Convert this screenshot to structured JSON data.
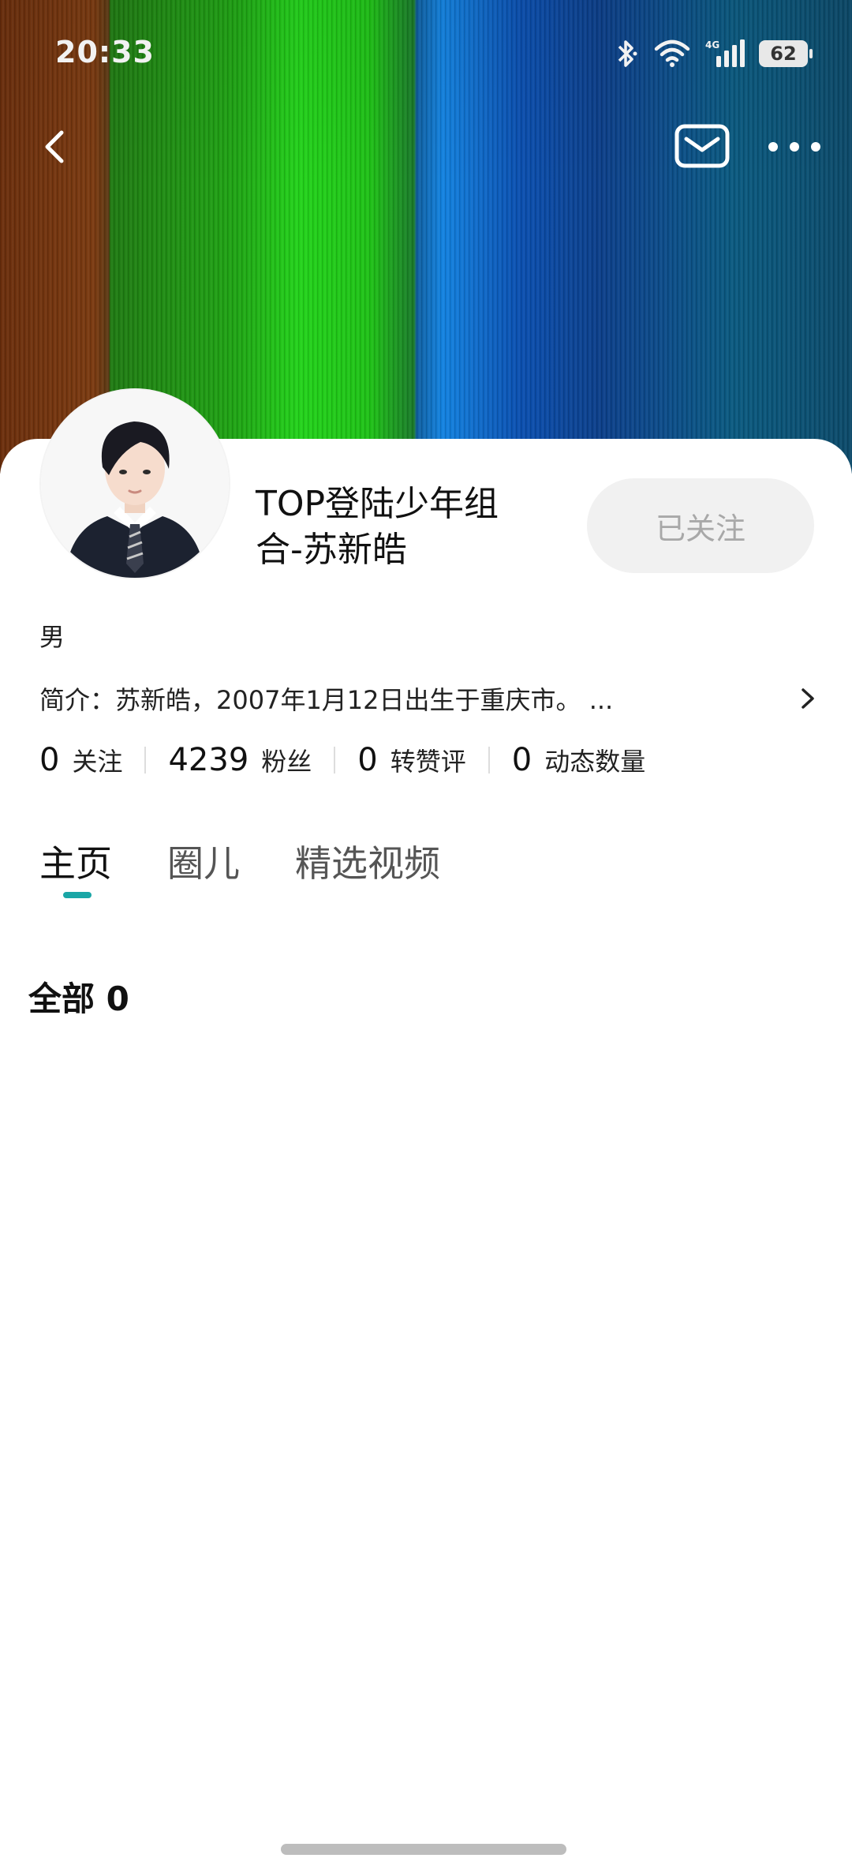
{
  "status_bar": {
    "time": "20:33",
    "battery_level": "62",
    "icons": [
      "bluetooth-icon",
      "wifi-icon",
      "4g-signal-icon",
      "battery-icon"
    ]
  },
  "header": {
    "back_icon": "chevron-left-icon",
    "message_icon": "envelope-icon",
    "more_icon": "more-dots-icon"
  },
  "profile": {
    "name_line1": "TOP登陆少年组",
    "name_line2": "合-苏新皓",
    "follow_label": "已关注",
    "gender": "男",
    "bio": "简介：苏新皓，2007年1月12日出生于重庆市。 ..."
  },
  "stats": [
    {
      "value": "0",
      "label": "关注"
    },
    {
      "value": "4239",
      "label": "粉丝"
    },
    {
      "value": "0",
      "label": "转赞评"
    },
    {
      "value": "0",
      "label": "动态数量"
    }
  ],
  "tabs": [
    {
      "label": "主页",
      "active": true
    },
    {
      "label": "圈儿",
      "active": false
    },
    {
      "label": "精选视频",
      "active": false
    }
  ],
  "section": {
    "title": "全部 0"
  },
  "colors": {
    "accent": "#1aa6a6",
    "follow_button_bg": "#f1f1f1",
    "follow_button_text": "#a8a8a8"
  }
}
